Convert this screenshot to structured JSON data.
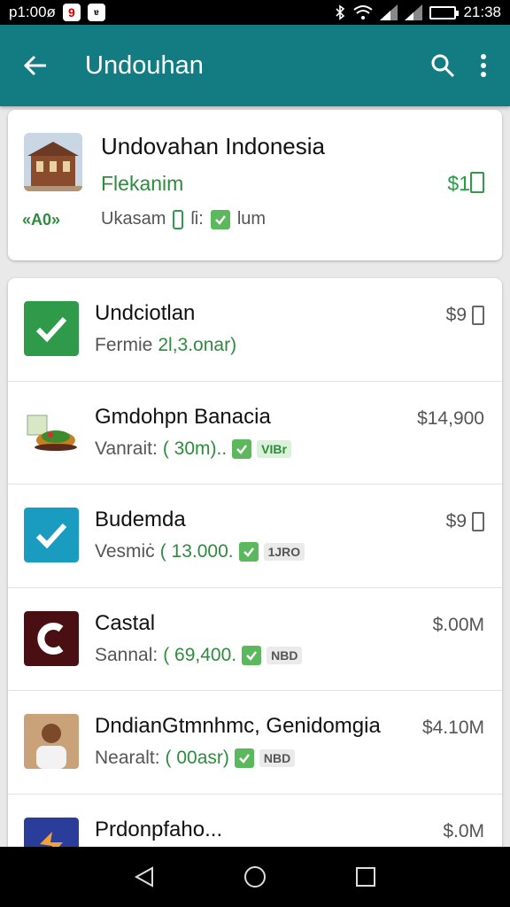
{
  "status_bar": {
    "left_text": "p1:00ø",
    "badge_red": "9",
    "badge_small": "ɐ",
    "time": "21:38"
  },
  "app_bar": {
    "title": "Undouhan"
  },
  "featured": {
    "title": "Undovahan Indonesia",
    "subtitle": "Flekanim",
    "price": "$1",
    "code": "«A0»",
    "meta_label": "Ukasam",
    "meta_mid": "ſi:",
    "meta_end": "lum"
  },
  "items": [
    {
      "title": "Undciotlan",
      "sub_label": "Fermie",
      "sub_value": "2l,3.onar)",
      "price": "$9",
      "tag": "",
      "icon": "green-check",
      "has_clip": true
    },
    {
      "title": "Gmdohpn Banacia",
      "sub_label": "Vanrait:",
      "sub_value": "( 30m)..",
      "price": "$14,900",
      "tag": "VIBr",
      "icon": "food",
      "has_clip": false
    },
    {
      "title": "Budemda",
      "sub_label": "Vesmiċ",
      "sub_value": "( 13.000.",
      "price": "$9",
      "tag": "1JRO",
      "icon": "teal-check",
      "has_clip": true
    },
    {
      "title": "Castal",
      "sub_label": "Sannal:",
      "sub_value": "( 69,400.",
      "price": "$.00M",
      "tag": "NBD",
      "icon": "maroon-c",
      "has_clip": false
    },
    {
      "title": "DndianGtmnhmc, Genidomgia",
      "sub_label": "Nearalt:",
      "sub_value": "( 00asr)",
      "price": "$4.10M",
      "tag": "NBD",
      "icon": "person",
      "has_clip": false
    },
    {
      "title": "Prdonpfaho...",
      "sub_label": "",
      "sub_value": "",
      "price": "$.0M",
      "tag": "",
      "icon": "blue-orange",
      "has_clip": false
    }
  ],
  "colors": {
    "app_bar": "#127c82",
    "accent_green": "#2e9a4a"
  }
}
